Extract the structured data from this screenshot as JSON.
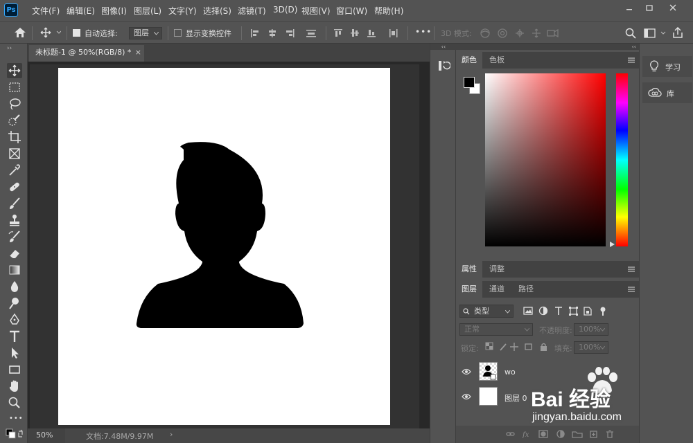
{
  "app": {
    "logo": "Ps",
    "menu": [
      "文件(F)",
      "编辑(E)",
      "图像(I)",
      "图层(L)",
      "文字(Y)",
      "选择(S)",
      "滤镜(T)",
      "3D(D)",
      "视图(V)",
      "窗口(W)",
      "帮助(H)"
    ]
  },
  "options": {
    "auto_select_label": "自动选择:",
    "auto_select_value": "图层",
    "show_transform_label": "显示变换控件",
    "more_label": "•••",
    "mode_3d_label": "3D 模式:"
  },
  "document": {
    "tab_title": "未标题-1 @ 50%(RGB/8) *",
    "tab_close": "×",
    "zoom": "50%",
    "doc_info": "文档:7.48M/9.97M",
    "status_arrow": "›"
  },
  "panels": {
    "collapse_left": "‹‹",
    "collapse_right": "‹‹",
    "color_tabs": [
      "颜色",
      "色板"
    ],
    "props_tabs": [
      "属性",
      "调整"
    ],
    "layer_tabs": [
      "图层",
      "通道",
      "路径"
    ],
    "filter_label": "类型",
    "blend_mode": "正常",
    "opacity_label": "不透明度:",
    "opacity_value": "100%",
    "lock_label": "锁定:",
    "fill_label": "填充:",
    "fill_value": "100%",
    "layers": [
      {
        "name": "wo"
      },
      {
        "name": "图层 0"
      }
    ]
  },
  "far": {
    "learn": "学习",
    "library": "库"
  },
  "toolbar_collapse": "››",
  "colors": {
    "foreground": "#000000",
    "background": "#ffffff",
    "accent": "#31a8ff"
  },
  "watermark": {
    "brand": "Bai 经验",
    "url": "jingyan.baidu.com"
  }
}
